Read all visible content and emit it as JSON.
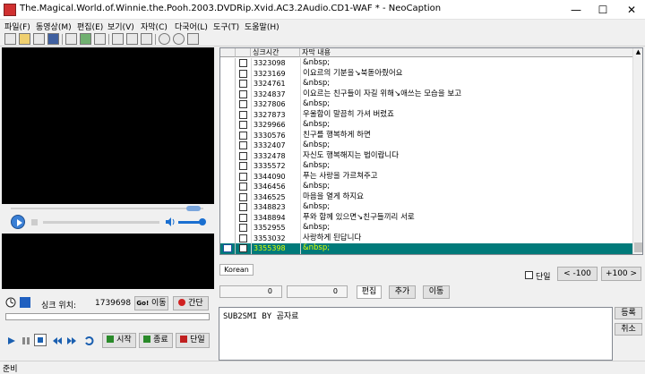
{
  "window": {
    "title": "The.Magical.World.of.Winnie.the.Pooh.2003.DVDRip.Xvid.AC3.2Audio.CD1-WAF * - NeoCaption"
  },
  "menu": [
    {
      "label": "파일(F)"
    },
    {
      "label": "동영상(M)"
    },
    {
      "label": "편집(E)"
    },
    {
      "label": "보기(V)"
    },
    {
      "label": "자막(C)"
    },
    {
      "label": "다국어(L)"
    },
    {
      "label": "도구(T)"
    },
    {
      "label": "도움말(H)"
    }
  ],
  "grid": {
    "headers": {
      "sync": "싱크시간",
      "text": "자막 내용"
    },
    "rows": [
      {
        "time": "3323098",
        "text": "&nbsp;"
      },
      {
        "time": "3323169",
        "text": "이요르의 기분을↘북돋아줬어요"
      },
      {
        "time": "3324761",
        "text": "&nbsp;"
      },
      {
        "time": "3324837",
        "text": "이요르는 친구들이 자길 위해↘애쓰는 모습을 보고"
      },
      {
        "time": "3327806",
        "text": "&nbsp;"
      },
      {
        "time": "3327873",
        "text": "우울함이 말끔히 가셔 버렸죠"
      },
      {
        "time": "3329966",
        "text": "&nbsp;"
      },
      {
        "time": "3330576",
        "text": "친구를 행복하게 하면"
      },
      {
        "time": "3332407",
        "text": "&nbsp;"
      },
      {
        "time": "3332478",
        "text": "자신도 행복해지는 법이랍니다"
      },
      {
        "time": "3335572",
        "text": "&nbsp;"
      },
      {
        "time": "3344090",
        "text": "푸는 사랑을 가르쳐주고"
      },
      {
        "time": "3346456",
        "text": "&nbsp;"
      },
      {
        "time": "3346525",
        "text": "마음을 열게 하지요"
      },
      {
        "time": "3348823",
        "text": "&nbsp;"
      },
      {
        "time": "3348894",
        "text": "푸와 함께 있으면↘친구들끼리 서로"
      },
      {
        "time": "3352955",
        "text": "&nbsp;"
      },
      {
        "time": "3353032",
        "text": "사랑하게 된답니다"
      },
      {
        "time": "3355398",
        "text": "&nbsp;",
        "selected": true
      }
    ]
  },
  "sync": {
    "label": "싱크 위치:",
    "value": "1739698",
    "goto_label": "이동",
    "goto_prefix": "Go!",
    "gap_label": "간단"
  },
  "transport": {
    "start_label": "시작",
    "end_label": "종료",
    "single_label": "단일"
  },
  "lang_tab": {
    "label": "Korean"
  },
  "single_check": {
    "label": "단일"
  },
  "nav": {
    "minus100": "< -100",
    "plus100": "+100 >"
  },
  "edit_row": {
    "spin1": "0",
    "spin2": "0",
    "edit_label": "편집",
    "add_label": "추가",
    "move_label": "이동"
  },
  "editor": {
    "text": "SUB2SMI BY 곰자료"
  },
  "side": {
    "register_label": "등록",
    "cancel_label": "취소"
  },
  "status": {
    "text": "준비"
  },
  "colors": {
    "selected_row_bg": "#007a7a",
    "selected_row_fg": "#e0ff00",
    "volume_blue": "#1a6fd0"
  }
}
